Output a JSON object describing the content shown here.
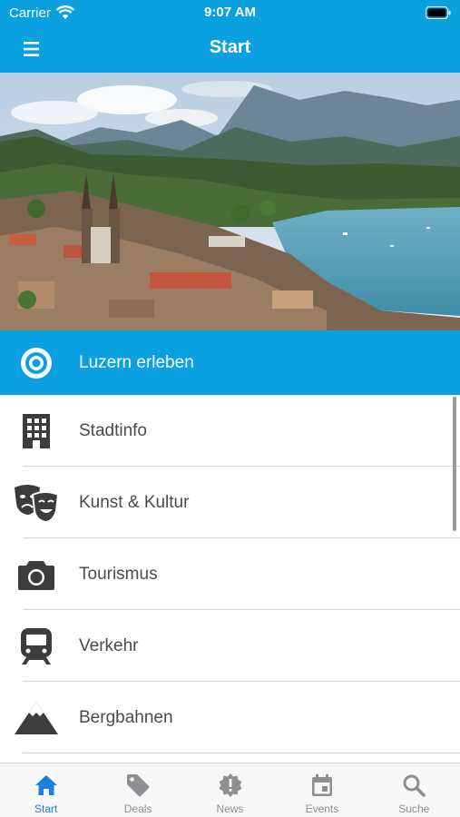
{
  "status_bar": {
    "carrier": "Carrier",
    "time": "9:07 AM"
  },
  "nav": {
    "title": "Start",
    "menu_icon": "hamburger-menu-icon"
  },
  "hero": {
    "description": "lucerne-city-lake-panorama-photo"
  },
  "menu": {
    "items": [
      {
        "label": "Luzern erleben",
        "icon": "target-icon",
        "active": true
      },
      {
        "label": "Stadtinfo",
        "icon": "building-icon"
      },
      {
        "label": "Kunst & Kultur",
        "icon": "theater-masks-icon"
      },
      {
        "label": "Tourismus",
        "icon": "camera-icon"
      },
      {
        "label": "Verkehr",
        "icon": "train-icon"
      },
      {
        "label": "Bergbahnen",
        "icon": "mountain-icon"
      }
    ]
  },
  "tabbar": {
    "tabs": [
      {
        "label": "Start",
        "icon": "home-icon",
        "active": true
      },
      {
        "label": "Deals",
        "icon": "tag-icon"
      },
      {
        "label": "News",
        "icon": "alert-badge-icon"
      },
      {
        "label": "Events",
        "icon": "calendar-icon"
      },
      {
        "label": "Suche",
        "icon": "search-icon"
      }
    ]
  },
  "colors": {
    "primary": "#0ba0e0",
    "tab_active": "#1a7fe0",
    "tab_inactive": "#8e8e93",
    "icon_gray": "#3c3c3c"
  }
}
